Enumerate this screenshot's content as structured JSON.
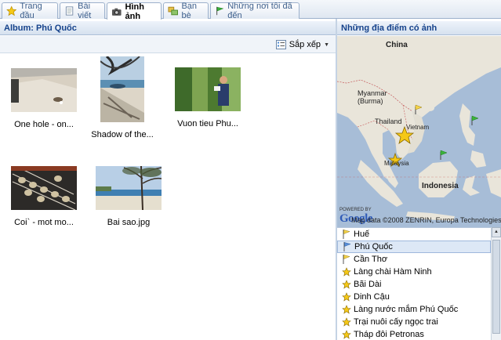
{
  "tabs": [
    {
      "label": "Trang đầu",
      "icon": "star-icon"
    },
    {
      "label": "Bài viết",
      "icon": "document-icon"
    },
    {
      "label": "Hình ảnh",
      "icon": "camera-icon",
      "active": true
    },
    {
      "label": "Bạn bè",
      "icon": "friends-icon"
    },
    {
      "label": "Những nơi tôi đã đến",
      "icon": "flag-icon"
    }
  ],
  "album": {
    "title": "Album: Phú Quốc",
    "sort_label": "Sắp xếp",
    "photos": [
      {
        "caption": "One hole - on..."
      },
      {
        "caption": "Shadow of the..."
      },
      {
        "caption": "Vuon tieu Phu..."
      },
      {
        "caption": "Coi` - mot mo..."
      },
      {
        "caption": "Bai sao.jpg"
      }
    ]
  },
  "map_panel": {
    "title": "Những địa điểm có ảnh",
    "labels": {
      "china": "China",
      "myanmar": "Myanmar\n(Burma)",
      "thailand": "Thailand",
      "vietnam": "Vietnam",
      "malaysia": "Malaysia",
      "indonesia": "Indonesia"
    },
    "copyright": "Map data ©2008 ZENRIN, Europa Technologies",
    "powered_by": "POWERED BY",
    "google": "Google"
  },
  "places": [
    {
      "name": "Huế",
      "selected": false
    },
    {
      "name": "Phú Quốc",
      "selected": true
    },
    {
      "name": "Cần Thơ",
      "selected": false
    },
    {
      "name": "Làng chài Hàm Ninh",
      "selected": false
    },
    {
      "name": "Bãi Dài",
      "selected": false
    },
    {
      "name": "Dinh Cậu",
      "selected": false
    },
    {
      "name": "Làng nước mắm Phú Quốc",
      "selected": false
    },
    {
      "name": "Trại nuôi cấy ngọc trai",
      "selected": false
    },
    {
      "name": "Tháp đôi Petronas",
      "selected": false
    }
  ],
  "colors": {
    "header_text": "#15428b",
    "tab_text": "#3d5f8c",
    "accent": "#9db1cc"
  }
}
